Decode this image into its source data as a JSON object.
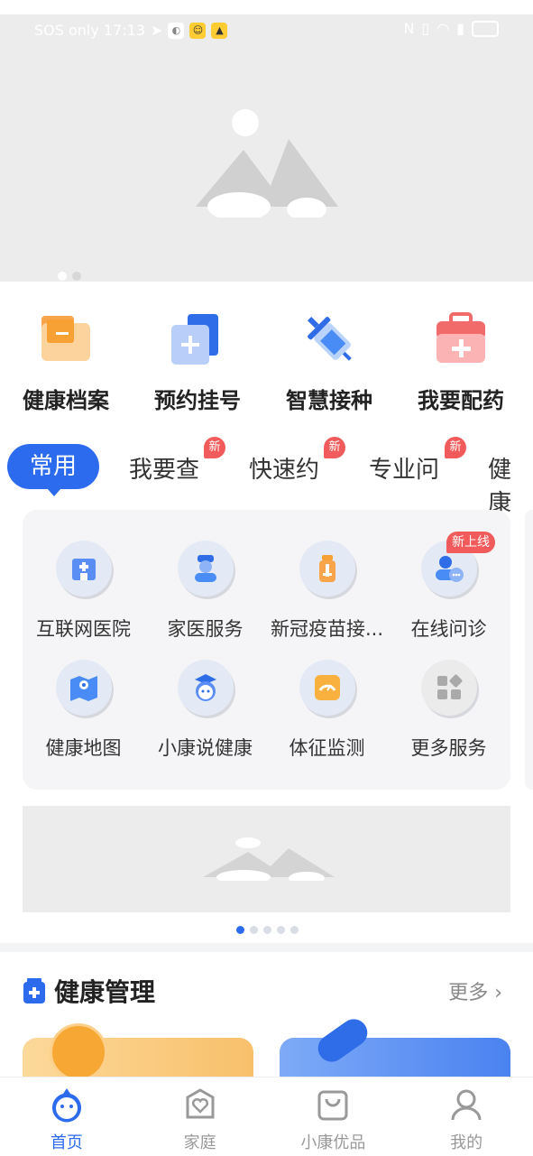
{
  "status_bar": {
    "left_text": "SOS only 17:13",
    "icons": [
      "telegram-icon",
      "browser-icon",
      "emoji-icon",
      "penguin-icon"
    ],
    "right_icons": [
      "nfc-icon",
      "vibrate-icon",
      "wifi-icon",
      "battery-icon"
    ]
  },
  "quick_actions": [
    {
      "label": "健康档案",
      "icon": "folder-icon",
      "color": "#f8a44a"
    },
    {
      "label": "预约挂号",
      "icon": "register-icon",
      "color": "#3f7af2"
    },
    {
      "label": "智慧接种",
      "icon": "syringe-icon",
      "color": "#4a8cf5"
    },
    {
      "label": "我要配药",
      "icon": "medicine-kit-icon",
      "color": "#f26b6b"
    }
  ],
  "tabs": [
    {
      "label": "常用",
      "active": true,
      "badge": ""
    },
    {
      "label": "我要查",
      "active": false,
      "badge": "新"
    },
    {
      "label": "快速约",
      "active": false,
      "badge": "新"
    },
    {
      "label": "专业问",
      "active": false,
      "badge": "新"
    },
    {
      "label": "健康",
      "active": false,
      "badge": ""
    }
  ],
  "services": [
    {
      "label": "互联网医院",
      "icon": "hospital-icon",
      "color": "#5b8ef5",
      "badge": ""
    },
    {
      "label": "家医服务",
      "icon": "doctor-icon",
      "color": "#4a8cf5",
      "badge": ""
    },
    {
      "label": "新冠疫苗接...",
      "icon": "vaccine-icon",
      "color": "#f8a44a",
      "badge": ""
    },
    {
      "label": "在线问诊",
      "icon": "online-consult-icon",
      "color": "#3f7af2",
      "badge": "新上线"
    },
    {
      "label": "健康地图",
      "icon": "map-icon",
      "color": "#3f7af2",
      "badge": ""
    },
    {
      "label": "小康说健康",
      "icon": "mascot-icon",
      "color": "#3f7af2",
      "badge": ""
    },
    {
      "label": "体征监测",
      "icon": "monitor-icon",
      "color": "#f8b13f",
      "badge": ""
    },
    {
      "label": "更多服务",
      "icon": "more-grid-icon",
      "color": "#999999",
      "badge": ""
    }
  ],
  "health_management": {
    "title": "健康管理",
    "more_label": "更多 ›"
  },
  "bottom_nav": [
    {
      "label": "首页",
      "icon": "home-mascot-icon",
      "active": true
    },
    {
      "label": "家庭",
      "icon": "family-heart-icon",
      "active": false
    },
    {
      "label": "小康优品",
      "icon": "shopping-bag-icon",
      "active": false
    },
    {
      "label": "我的",
      "icon": "profile-icon",
      "active": false
    }
  ],
  "colors": {
    "accent": "#2c6bee",
    "badge": "#f25b5b",
    "panel": "#f5f5f7",
    "placeholder": "#ececec"
  }
}
